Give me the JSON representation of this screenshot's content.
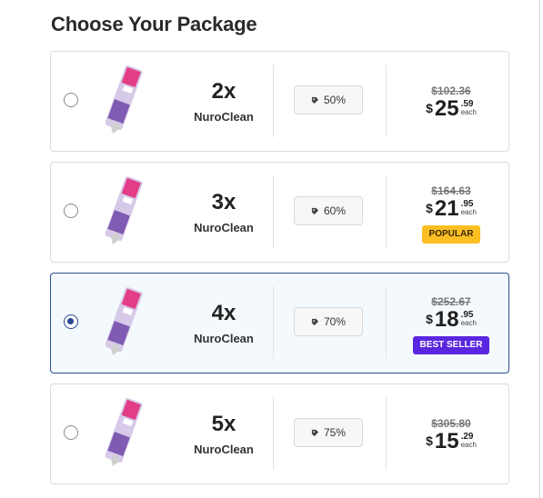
{
  "page": {
    "title": "Choose Your Package"
  },
  "packages": [
    {
      "qty": "2x",
      "product_name": "NuroClean",
      "discount": "50%",
      "old_price": "$102.36",
      "currency": "$",
      "price_dollars": "25",
      "price_cents": ".59",
      "each": "each",
      "badge": "",
      "selected": false
    },
    {
      "qty": "3x",
      "product_name": "NuroClean",
      "discount": "60%",
      "old_price": "$164.63",
      "currency": "$",
      "price_dollars": "21",
      "price_cents": ".95",
      "each": "each",
      "badge": "POPULAR",
      "selected": false
    },
    {
      "qty": "4x",
      "product_name": "NuroClean",
      "discount": "70%",
      "old_price": "$252.67",
      "currency": "$",
      "price_dollars": "18",
      "price_cents": ".95",
      "each": "each",
      "badge": "BEST SELLER",
      "selected": true
    },
    {
      "qty": "5x",
      "product_name": "NuroClean",
      "discount": "75%",
      "old_price": "$305.80",
      "currency": "$",
      "price_dollars": "15",
      "price_cents": ".29",
      "each": "each",
      "badge": "",
      "selected": false
    }
  ],
  "colors": {
    "selected_border": "#2f4f8c",
    "popular_badge": "#fbbf24",
    "best_seller_badge": "#5b26e0"
  },
  "icons": {
    "product": "tube-image",
    "discount": "tag-icon",
    "radio": "radio-icon"
  }
}
